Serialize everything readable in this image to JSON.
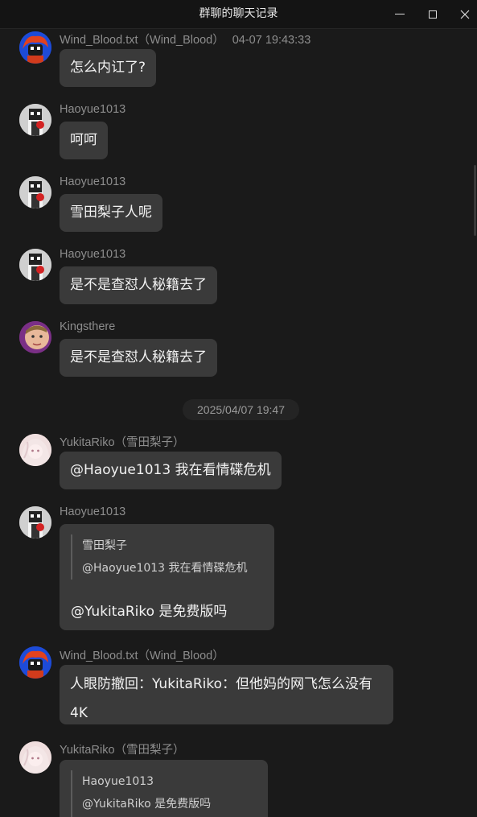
{
  "window": {
    "title": "群聊的聊天记录",
    "controls": {
      "minimize": "—",
      "maximize": "☐",
      "close": "✕"
    }
  },
  "divider": {
    "date": "2025/04/07 19:47"
  },
  "messages": [
    {
      "sender": "Wind_Blood.txt（Wind_Blood）",
      "time": "04-07 19:43:33",
      "avatar": "wind-blood-avatar",
      "text": "怎么内讧了?"
    },
    {
      "sender": "Haoyue1013",
      "avatar": "haoyue-avatar",
      "text": "呵呵"
    },
    {
      "sender": "Haoyue1013",
      "avatar": "haoyue-avatar",
      "text": "雪田梨子人呢"
    },
    {
      "sender": "Haoyue1013",
      "avatar": "haoyue-avatar",
      "text": "是不是查怼人秘籍去了"
    },
    {
      "sender": "Kingsthere",
      "avatar": "kingsthere-avatar",
      "text": "是不是查怼人秘籍去了"
    },
    {
      "sender": "YukitaRiko（雪田梨子）",
      "avatar": "yukitariko-avatar",
      "text": "@Haoyue1013 我在看情碟危机"
    },
    {
      "sender": "Haoyue1013",
      "avatar": "haoyue-avatar",
      "quote": {
        "author": "雪田梨子",
        "text": "@Haoyue1013 我在看情碟危机"
      },
      "text": "@YukitaRiko 是免费版吗"
    },
    {
      "sender": "Wind_Blood.txt（Wind_Blood）",
      "avatar": "wind-blood-avatar",
      "text": "人眼防撤回：YukitaRiko：但他妈的网飞怎么没有4K"
    },
    {
      "sender": "YukitaRiko（雪田梨子）",
      "avatar": "yukitariko-avatar",
      "quote": {
        "author": "Haoyue1013",
        "text": "@YukitaRiko 是免费版吗"
      }
    }
  ]
}
